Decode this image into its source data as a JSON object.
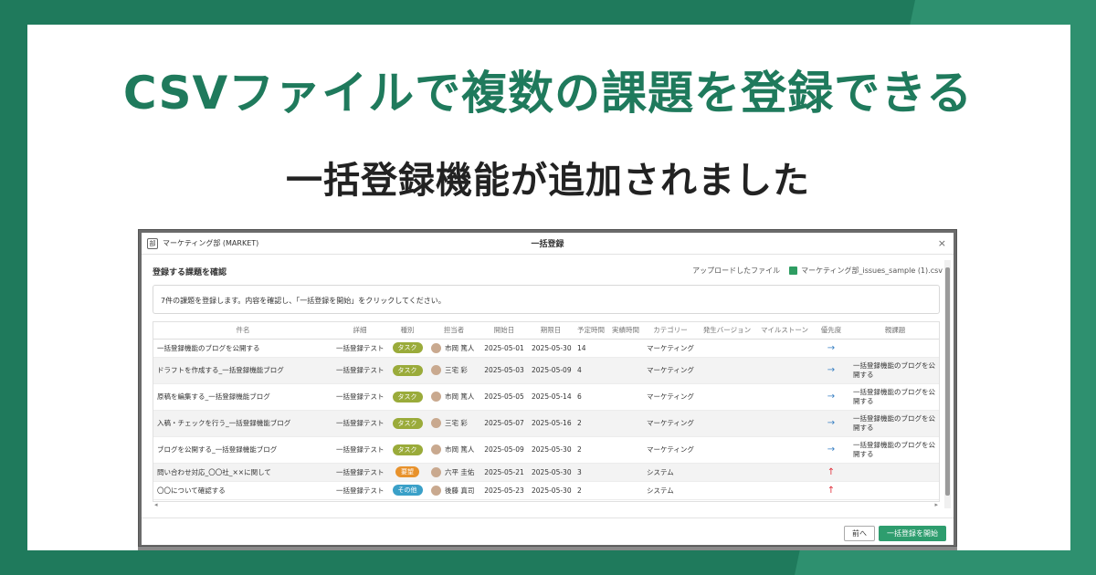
{
  "banner": {
    "headline": "CSVファイルで複数の課題を登録できる",
    "subline": "一括登録機能が追加されました"
  },
  "dialog": {
    "project_name": "マーケティング部 (MARKET)",
    "project_icon": "部",
    "title": "一括登録",
    "close": "×",
    "section_heading": "登録する課題を確認",
    "uploaded_label": "アップロードしたファイル",
    "uploaded_file": "マーケティング部_issues_sample (1).csv",
    "notice": "7件の課題を登録します。内容を確認し、「一括登録を開始」をクリックしてください。",
    "columns": [
      "件名",
      "詳細",
      "種別",
      "担当者",
      "開始日",
      "期限日",
      "予定時間",
      "実績時間",
      "カテゴリー",
      "発生バージョン",
      "マイルストーン",
      "優先度",
      "親課題"
    ],
    "rows": [
      {
        "subject": "一括登録機能のブログを公開する",
        "detail": "一括登録テスト",
        "type": "タスク",
        "type_color": "#9aab3a",
        "assignee": "市岡 篤人",
        "start": "2025-05-01",
        "due": "2025-05-30",
        "estimate": "14",
        "actual": "",
        "category": "マーケティング",
        "version": "",
        "milestone": "",
        "priority": "→",
        "priority_color": "#3b82c4",
        "parent": ""
      },
      {
        "subject": "ドラフトを作成する_一括登録機能ブログ",
        "detail": "一括登録テスト",
        "type": "タスク",
        "type_color": "#9aab3a",
        "assignee": "三宅 彩",
        "start": "2025-05-03",
        "due": "2025-05-09",
        "estimate": "4",
        "actual": "",
        "category": "マーケティング",
        "version": "",
        "milestone": "",
        "priority": "→",
        "priority_color": "#3b82c4",
        "parent": "一括登録機能のブログを公開する"
      },
      {
        "subject": "原稿を編集する_一括登録機能ブログ",
        "detail": "一括登録テスト",
        "type": "タスク",
        "type_color": "#9aab3a",
        "assignee": "市岡 篤人",
        "start": "2025-05-05",
        "due": "2025-05-14",
        "estimate": "6",
        "actual": "",
        "category": "マーケティング",
        "version": "",
        "milestone": "",
        "priority": "→",
        "priority_color": "#3b82c4",
        "parent": "一括登録機能のブログを公開する"
      },
      {
        "subject": "入稿・チェックを行う_一括登録機能ブログ",
        "detail": "一括登録テスト",
        "type": "タスク",
        "type_color": "#9aab3a",
        "assignee": "三宅 彩",
        "start": "2025-05-07",
        "due": "2025-05-16",
        "estimate": "2",
        "actual": "",
        "category": "マーケティング",
        "version": "",
        "milestone": "",
        "priority": "→",
        "priority_color": "#3b82c4",
        "parent": "一括登録機能のブログを公開する"
      },
      {
        "subject": "ブログを公開する_一括登録機能ブログ",
        "detail": "一括登録テスト",
        "type": "タスク",
        "type_color": "#9aab3a",
        "assignee": "市岡 篤人",
        "start": "2025-05-09",
        "due": "2025-05-30",
        "estimate": "2",
        "actual": "",
        "category": "マーケティング",
        "version": "",
        "milestone": "",
        "priority": "→",
        "priority_color": "#3b82c4",
        "parent": "一括登録機能のブログを公開する"
      },
      {
        "subject": "問い合わせ対応_〇〇社_××に関して",
        "detail": "一括登録テスト",
        "type": "要望",
        "type_color": "#e8922c",
        "assignee": "六平 圭佑",
        "start": "2025-05-21",
        "due": "2025-05-30",
        "estimate": "3",
        "actual": "",
        "category": "システム",
        "version": "",
        "milestone": "",
        "priority": "↑",
        "priority_color": "#e0303c",
        "parent": ""
      },
      {
        "subject": "〇〇について確認する",
        "detail": "一括登録テスト",
        "type": "その他",
        "type_color": "#3aa0c8",
        "assignee": "後藤 真司",
        "start": "2025-05-23",
        "due": "2025-05-30",
        "estimate": "2",
        "actual": "",
        "category": "システム",
        "version": "",
        "milestone": "",
        "priority": "↑",
        "priority_color": "#e0303c",
        "parent": ""
      }
    ],
    "scroll_left": "◂",
    "scroll_right": "▸",
    "prev_button": "前へ",
    "start_button": "一括登録を開始"
  }
}
